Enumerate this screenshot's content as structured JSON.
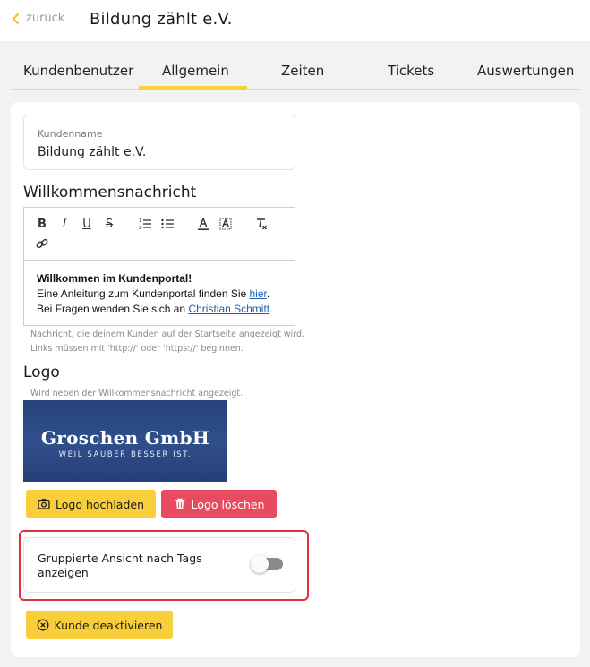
{
  "header": {
    "back_label": "zurück",
    "title": "Bildung zählt e.V."
  },
  "tabs": [
    {
      "label": "Kundenbenutzer"
    },
    {
      "label": "Allgemein"
    },
    {
      "label": "Zeiten"
    },
    {
      "label": "Tickets"
    },
    {
      "label": "Auswertungen"
    }
  ],
  "active_tab": "Allgemein",
  "customer": {
    "name_label": "Kundenname",
    "name_value": "Bildung zählt e.V."
  },
  "welcome": {
    "title": "Willkommensnachricht",
    "toolbar": {
      "bold": "B",
      "italic": "I",
      "underline": "U",
      "strike": "S"
    },
    "content": {
      "heading": "Willkommen im Kundenportal!",
      "line1_prefix": "Eine Anleitung zum Kundenportal finden Sie ",
      "line1_link": "hier",
      "line1_suffix": ".",
      "line2_prefix": "Bei Fragen wenden Sie sich an ",
      "line2_link": "Christian Schmitt",
      "line2_suffix": "."
    },
    "hint_line1": "Nachricht, die deinem Kunden auf der Startseite angezeigt wird.",
    "hint_line2": "Links müssen mit 'http://' oder 'https://' beginnen."
  },
  "logo": {
    "title": "Logo",
    "hint": "Wird neben der Willkommensnachricht angezeigt.",
    "image_text": "Groschen GmbH",
    "image_subtext": "WEIL SAUBER BESSER IST.",
    "upload_label": "Logo hochladen",
    "delete_label": "Logo löschen"
  },
  "grouped_view": {
    "label": "Gruppierte Ansicht nach Tags anzeigen",
    "enabled": false
  },
  "deactivate_label": "Kunde deaktivieren",
  "colors": {
    "accent_yellow": "#f8cf3b",
    "danger_red": "#e84a5f",
    "highlight_red": "#e0303a",
    "link_blue": "#1f5fae"
  }
}
